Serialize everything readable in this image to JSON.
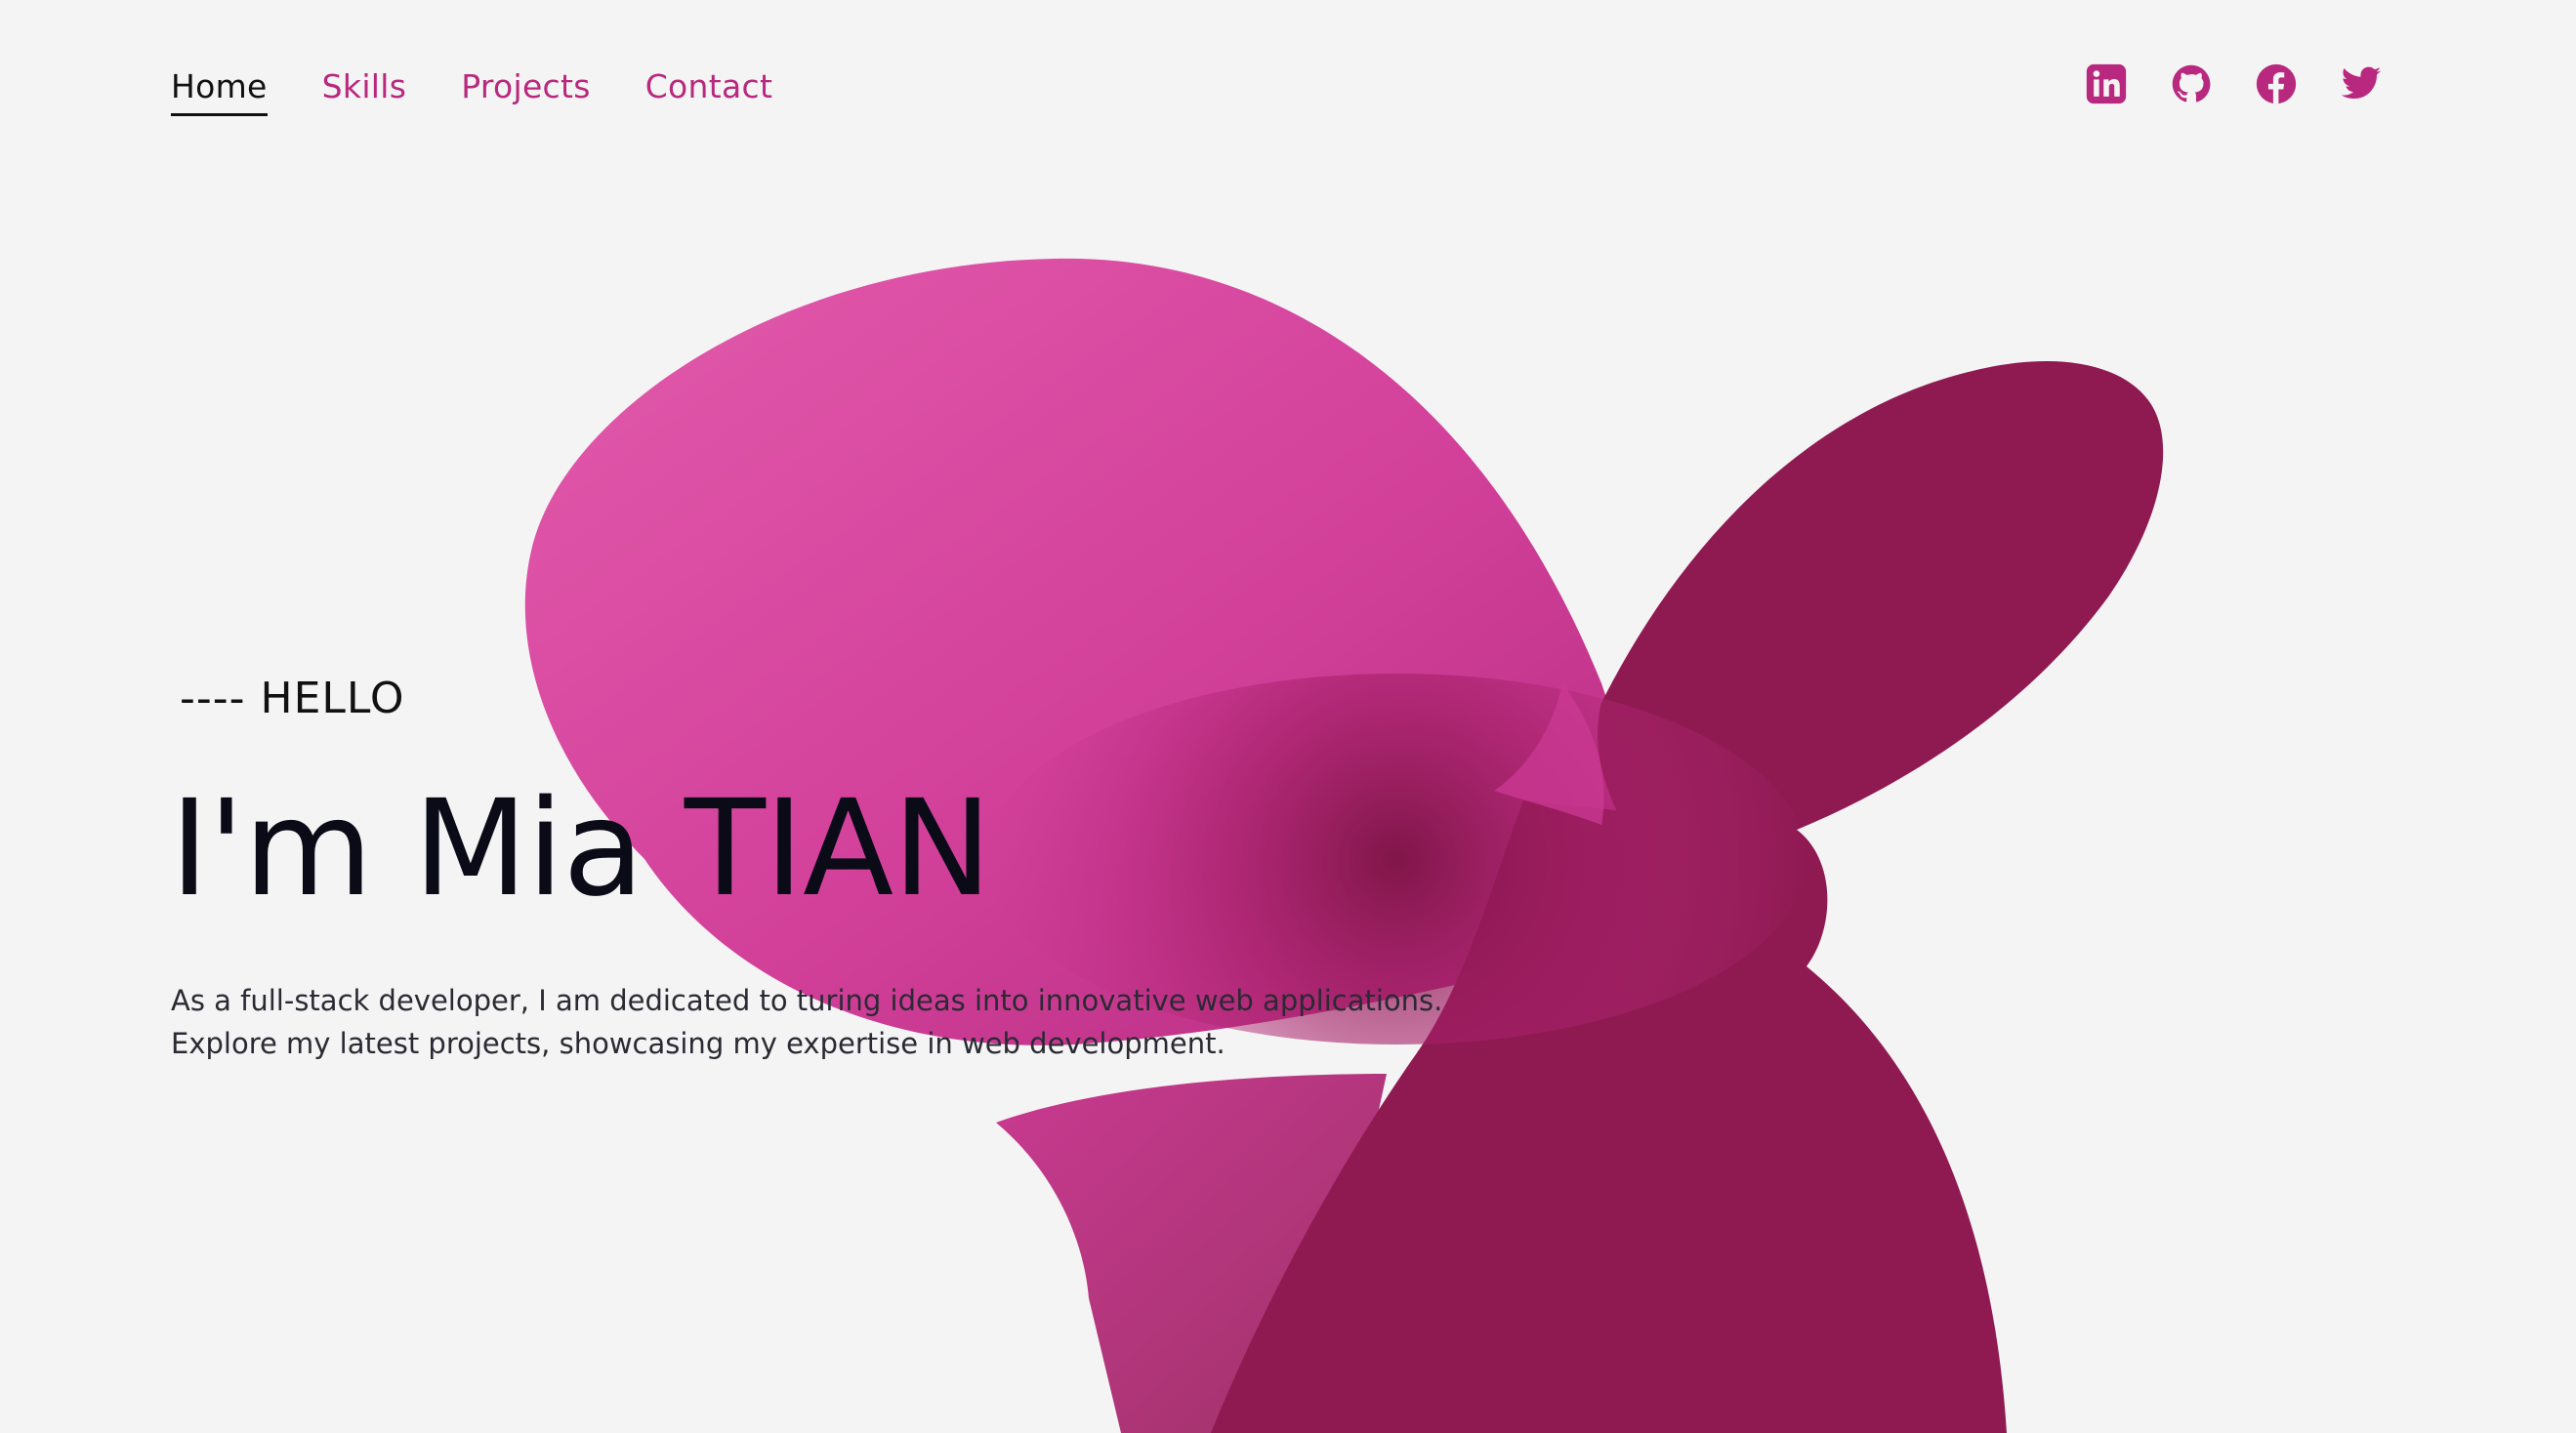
{
  "nav": {
    "items": [
      {
        "label": "Home",
        "active": true
      },
      {
        "label": "Skills",
        "active": false
      },
      {
        "label": "Projects",
        "active": false
      },
      {
        "label": "Contact",
        "active": false
      }
    ]
  },
  "social": {
    "icons": [
      "linkedin-icon",
      "github-icon",
      "facebook-icon",
      "twitter-icon"
    ]
  },
  "hero": {
    "eyebrow": "---- HELLO",
    "title": "I'm Mia TIAN",
    "description_lines": [
      "As a full-stack developer, I am dedicated to turing ideas into innovative web applications.",
      "Explore my latest projects, showcasing my expertise in web development."
    ]
  },
  "colors": {
    "accent": "#b8287e",
    "accent_dark": "#8e1a52",
    "accent_light": "#e056a9",
    "background": "#f4f4f4",
    "text": "#0b0b18"
  }
}
